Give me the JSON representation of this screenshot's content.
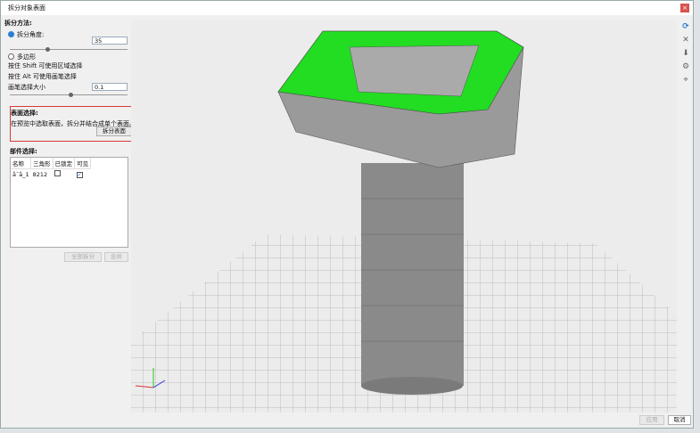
{
  "window": {
    "title": "拆分对象表面",
    "close_label": "×"
  },
  "split_method": {
    "heading": "拆分方法:",
    "angle_label": "拆分角度:",
    "angle_value": "35",
    "angle_slider": 0.45,
    "polygon_label": "多边形",
    "hint_shift": "按住 Shift 可使用区域选择",
    "hint_alt": "按住 Alt 可使用画笔选择",
    "brush_label": "画笔选择大小",
    "brush_value": "0.1",
    "brush_slider": 0.5
  },
  "surface": {
    "heading": "表面选择:",
    "hint": "在预览中选取表面，拆分并结合成单个表面。",
    "split_button": "拆分表面"
  },
  "parts": {
    "heading": "部件选择:",
    "columns": [
      "名称",
      "三角形",
      "已锁定",
      "可见"
    ],
    "rows": [
      {
        "name": "å¯å_1",
        "triangles": "8212",
        "locked": false,
        "visible": true
      }
    ],
    "split_all": "全部拆分",
    "merge": "合并"
  },
  "footer": {
    "apply": "应用",
    "cancel": "取消"
  },
  "colors": {
    "selected_faces": "#22dd22",
    "mesh": "#8a8a8a",
    "highlight": "#d9383a"
  }
}
